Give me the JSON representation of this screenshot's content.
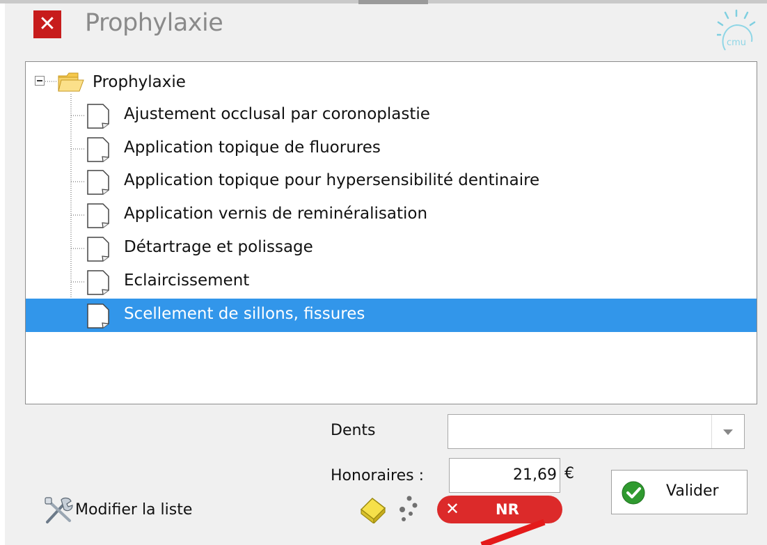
{
  "dialog": {
    "title": "Prophylaxie",
    "close_icon": "close-icon",
    "logo_icon": "cmu-logo",
    "logo_text": "cmu"
  },
  "tree": {
    "root": {
      "label": "Prophylaxie",
      "expanded": true,
      "icon": "folder-open-icon"
    },
    "items": [
      {
        "label": "Ajustement occlusal par coronoplastie",
        "icon": "document-icon",
        "selected": false
      },
      {
        "label": "Application topique de fluorures",
        "icon": "document-icon",
        "selected": false
      },
      {
        "label": "Application topique pour hypersensibilité dentinaire",
        "icon": "document-icon",
        "selected": false
      },
      {
        "label": "Application vernis de reminéralisation",
        "icon": "document-icon",
        "selected": false
      },
      {
        "label": "Détartrage et polissage",
        "icon": "document-icon",
        "selected": false
      },
      {
        "label": "Eclaircissement",
        "icon": "document-icon",
        "selected": false
      },
      {
        "label": "Scellement de sillons, fissures",
        "icon": "document-icon",
        "selected": true
      }
    ],
    "selection_color": "#3296ea"
  },
  "form": {
    "dents_label": "Dents",
    "dents_value": "",
    "honoraires_label": "Honoraires :",
    "honoraires_value": "21,69",
    "currency": "€"
  },
  "actions": {
    "modifier_label": "Modifier la liste",
    "valider_label": "Valider",
    "nr_label": "NR",
    "nr_x": "✕",
    "nr_color": "#dc2a2a",
    "close_glyph": "✕"
  }
}
